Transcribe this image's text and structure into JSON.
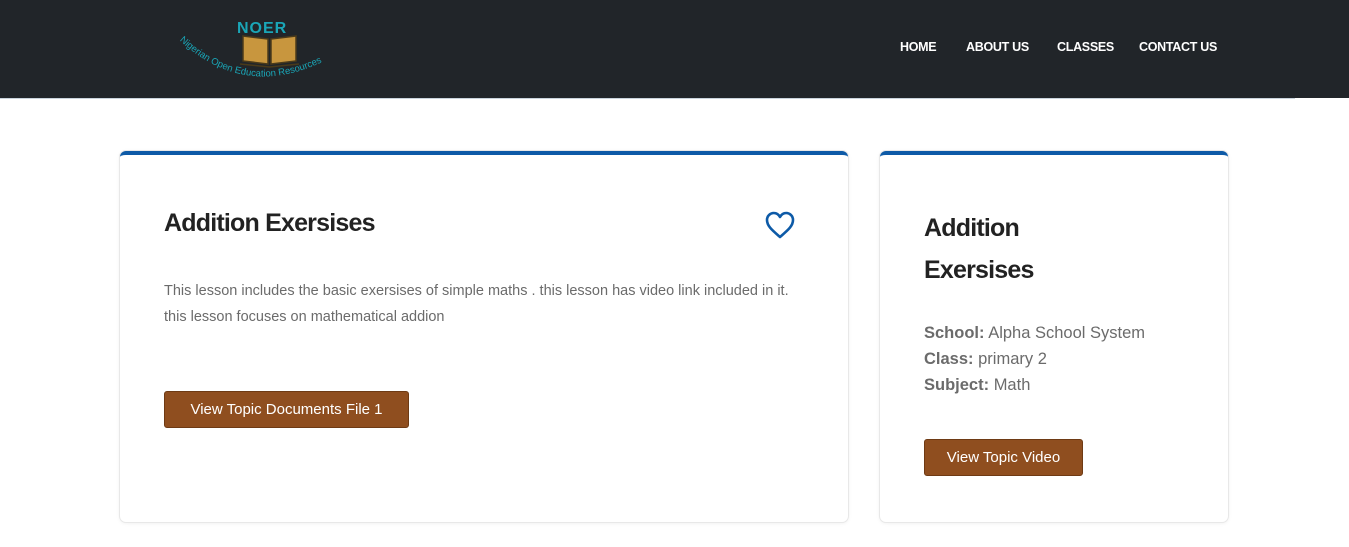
{
  "brand": {
    "logo_text": "NOER",
    "logo_tagline": "Nigerian Open Education Resources"
  },
  "nav": {
    "items": [
      {
        "label": "HOME"
      },
      {
        "label": "ABOUT US"
      },
      {
        "label": "CLASSES"
      },
      {
        "label": "CONTACT US"
      }
    ]
  },
  "lesson": {
    "title": "Addition Exersises",
    "description": "This lesson includes the basic exersises of simple maths . this lesson has video link included in it. this lesson focuses on mathematical addion",
    "documents_button": "View Topic Documents File 1",
    "favorite_icon": "heart-outline-icon"
  },
  "details": {
    "title": "Addition Exersises",
    "school_label": "School:",
    "school_value": "Alpha School System",
    "class_label": "Class:",
    "class_value": "primary 2",
    "subject_label": "Subject:",
    "subject_value": "Math",
    "video_button": "View Topic Video"
  },
  "colors": {
    "navbar": "#212529",
    "card_accent": "#0d5aa7",
    "button": "#8f4e1f",
    "logo_teal": "#1aa6b7",
    "logo_gold": "#c8963e"
  }
}
